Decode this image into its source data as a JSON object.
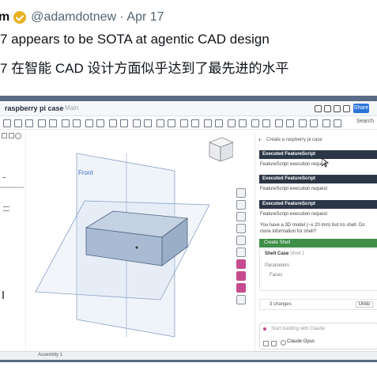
{
  "tweet": {
    "name": "m",
    "handle": "@adamdotnew",
    "separator": "·",
    "date": "Apr 17",
    "line1": "7 appears to be SOTA at agentic CAD design",
    "line2": "7 在智能 CAD 设计方面似乎达到了最先进的水平"
  },
  "app": {
    "doc_title": "raspberry pi case",
    "doc_sub": "Main",
    "share_label": "Share",
    "toolbar_end": "Search",
    "plane_label": "Front",
    "status_tab": "Assembly 1"
  },
  "chat": {
    "header": "Create a raspberry pi case",
    "messages": [
      {
        "title": "Executed FeatureScript",
        "detail": "FeatureScript execution request"
      },
      {
        "title": "Executed FeatureScript",
        "detail": "FeatureScript execution request"
      },
      {
        "title": "Executed FeatureScript",
        "detail": "FeatureScript execution request"
      }
    ],
    "summary": "You have a 3D model (~x 20 mm) but no shell. Do more information for shell?",
    "create_label": "Create Shell",
    "shell_label": "Shell Case",
    "shell_sub": "Shell 1",
    "param_label": "Parameters",
    "param_val": "Faces",
    "changes_label": "3 changes",
    "undo_label": "Undo",
    "input_placeholder": "Start building with Claude",
    "model_label": "Claude Opus"
  },
  "colors": {
    "accent": "#2a73d9",
    "verified": "#e8b020",
    "green": "#3f8f48",
    "bar": "#2b3646"
  }
}
